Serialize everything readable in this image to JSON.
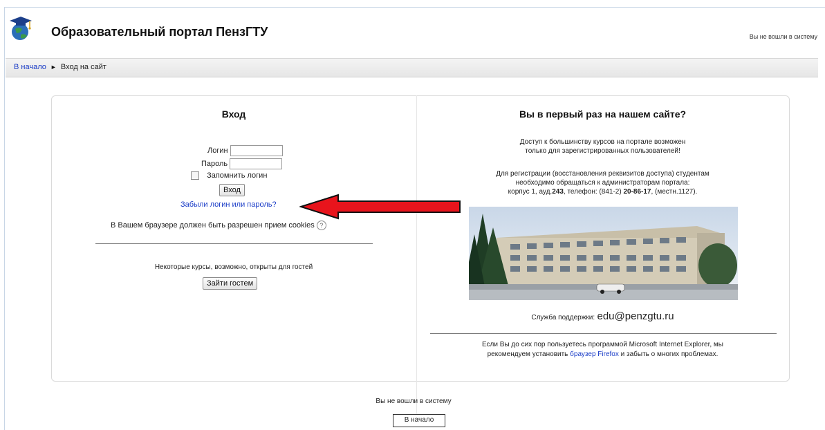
{
  "header": {
    "site_title": "Образовательный портал ПензГТУ",
    "login_info": "Вы не вошли в систему",
    "logo_icon": "graduation-cap-globe-icon"
  },
  "navbar": {
    "home_link": "В начало",
    "separator": "►",
    "current": "Вход на сайт"
  },
  "login": {
    "heading": "Вход",
    "username_label": "Логин",
    "username_value": "",
    "password_label": "Пароль",
    "password_value": "",
    "remember_label": "Запомнить логин",
    "remember_checked": false,
    "submit_label": "Вход",
    "forgot_link": "Забыли логин или пароль?",
    "cookies_notice": "В Вашем браузере должен быть разрешен прием cookies",
    "guest_notice": "Некоторые курсы, возможно, открыты для гостей",
    "guest_button": "Зайти гостем"
  },
  "signup": {
    "heading": "Вы в первый раз на нашем сайте?",
    "access_line1": "Доступ к большинству курсов на портале возможен",
    "access_line2": "только для зарегистрированных пользователей!",
    "reg_line1": "Для регистрации (восстановления реквизитов доступа) студентам",
    "reg_line2": "необходимо обращаться к администраторам портала:",
    "reg_line3_prefix": "корпус 1, ауд.",
    "reg_room": "243",
    "reg_line3_mid": ", телефон: (841-2) ",
    "reg_phone": "20-86-17",
    "reg_line3_suffix": ", (местн.1127).",
    "support_label": "Служба поддержки:",
    "support_email": "edu@penzgtu.ru",
    "ie_line1": "Если Вы до сих пор пользуетесь программой Microsoft Internet Explorer, мы",
    "ie_line2_prefix": "рекомендуем установить ",
    "ie_link": "браузер Firefox",
    "ie_line2_suffix": " и забыть о многих проблемах."
  },
  "footer": {
    "login_info": "Вы не вошли в систему",
    "home_button": "В начало"
  },
  "colors": {
    "link": "#1a3cc7",
    "arrow_fill": "#e8141c",
    "arrow_stroke": "#111111"
  }
}
